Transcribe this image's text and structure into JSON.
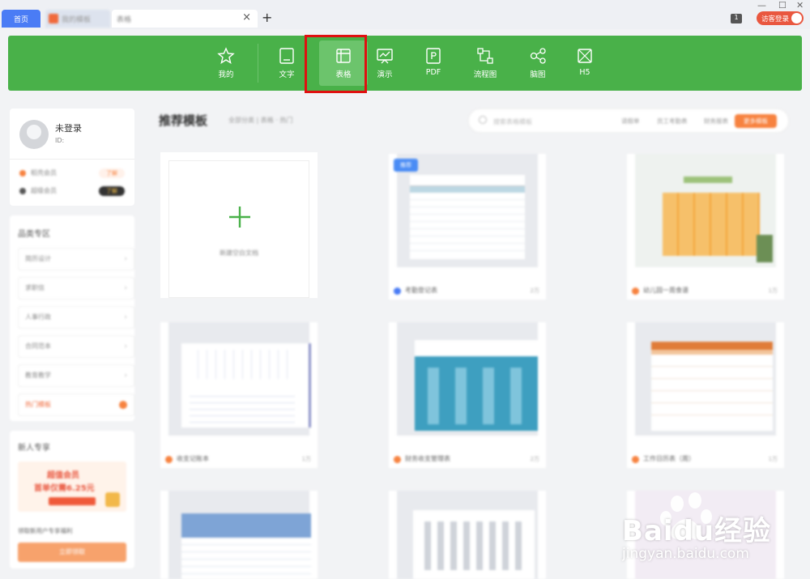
{
  "titlebar": {
    "tabs": [
      {
        "label": "首页"
      },
      {
        "label": "我的模板"
      },
      {
        "label": "表格"
      }
    ],
    "tab_close": "×",
    "new_tab": "+",
    "badge": "1",
    "login": "访客登录",
    "window_controls": [
      "—",
      "☐",
      "✕"
    ]
  },
  "toolbar": {
    "items": [
      {
        "label": "我的",
        "icon": "star-icon"
      },
      {
        "label": "文字",
        "icon": "document-icon"
      },
      {
        "label": "表格",
        "icon": "spreadsheet-icon",
        "active": true
      },
      {
        "label": "演示",
        "icon": "presentation-icon"
      },
      {
        "label": "PDF",
        "icon": "pdf-icon"
      },
      {
        "label": "流程图",
        "icon": "flowchart-icon"
      },
      {
        "label": "脑图",
        "icon": "mindmap-icon"
      },
      {
        "label": "H5",
        "icon": "h5-icon"
      }
    ],
    "accent": "#49b149",
    "highlight_color": "#e01010"
  },
  "profile": {
    "name": "未登录",
    "id_label": "ID:",
    "rows": [
      {
        "label": "稻壳会员",
        "tag": "了解"
      },
      {
        "label": "超级会员",
        "tag": "了解"
      }
    ]
  },
  "sidebar": {
    "title": "品类专区",
    "items": [
      "简历设计",
      "求职信",
      "人事行政",
      "合同范本",
      "教育教学",
      "热门模板"
    ]
  },
  "promo": {
    "title": "新人专享",
    "banner_text": "超值会员",
    "price_text": "首单仅需6.25元",
    "desc": "领取新用户专享福利",
    "button": "立即领取"
  },
  "main": {
    "title": "推荐模板",
    "subtitle": "全部分类 | 表格 · 热门",
    "search_placeholder": "搜索表格模板",
    "chips": [
      "请假单",
      "员工考勤表",
      "财务报表"
    ],
    "hot_chip": "更多模板",
    "new_label": "新建空白文档",
    "new_badge": "推荐",
    "tiles": [
      {
        "title": "考勤登记表",
        "count": "2万",
        "dot": "#4a7cf5"
      },
      {
        "title": "幼儿园一周食谱",
        "count": "1万",
        "dot": "#f7823f"
      },
      {
        "title": "收支记账本",
        "count": "1万",
        "dot": "#f7823f"
      },
      {
        "title": "财务收支管理表",
        "count": "2万",
        "dot": "#f7823f"
      },
      {
        "title": "工作日历表（周）",
        "count": "1万",
        "dot": "#f7823f"
      }
    ]
  },
  "watermark": {
    "brand": "Baidu经验",
    "url": "jingyan.baidu.com"
  }
}
